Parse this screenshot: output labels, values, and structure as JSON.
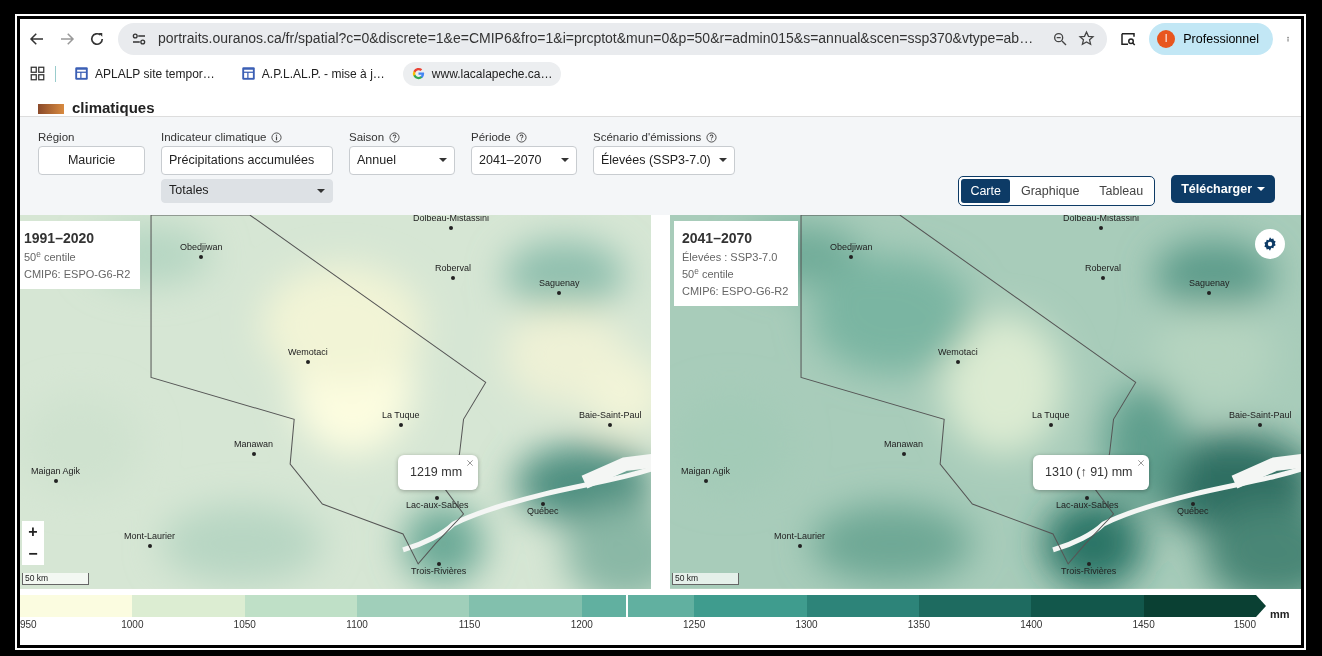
{
  "browser": {
    "url": "portraits.ouranos.ca/fr/spatial?c=0&discrete=1&e=CMIP6&fro=1&i=prcptot&mun=0&p=50&r=admin015&s=annual&scen=ssp370&vtype=ab…",
    "profile_initial": "I",
    "profile_name": "Professionnel"
  },
  "bookmarks": [
    {
      "kind": "page",
      "label": "APLALP site tempor…"
    },
    {
      "kind": "page",
      "label": "A.P.L.AL.P. - mise à j…"
    },
    {
      "kind": "google",
      "label": "www.lacalapeche.ca…"
    }
  ],
  "site_header": {
    "title": "climatiques"
  },
  "filters": [
    {
      "label": "Région",
      "kind": "button",
      "value": "Mauricie"
    },
    {
      "label": "Indicateur climatique",
      "info_button": true,
      "kind": "input",
      "value": "Précipitations accumulées",
      "sub_value": "Totales"
    },
    {
      "label": "Saison",
      "help_button": true,
      "kind": "select",
      "value": "Annuel"
    },
    {
      "label": "Période",
      "help_button": true,
      "kind": "select",
      "value": "2041–2070"
    },
    {
      "label": "Scénario d'émissions",
      "help_button": true,
      "kind": "select",
      "value": "Élevées (SSP3-7.0)"
    }
  ],
  "view_tabs": [
    {
      "label": "Carte",
      "selected": true
    },
    {
      "label": "Graphique",
      "selected": false
    },
    {
      "label": "Tableau",
      "selected": false
    }
  ],
  "download_button": "Télécharger",
  "maps": [
    {
      "title": "1991–2020",
      "lines": [
        "50$^{e}$ centile",
        "CMIP6: ESPO-G6-R2"
      ],
      "popup": "1219 mm",
      "zoom_buttons": [
        "+",
        "−"
      ],
      "scale": "50 km",
      "cities": [
        "Dolbeau-Mistassini",
        "Obedjiwan",
        "Roberval",
        "Saguenay",
        "Wemotaci",
        "La Tuque",
        "Manawan",
        "Maigan Agik",
        "Baie-Saint-Paul",
        "Lac-aux-Sables",
        "Québec",
        "Mont-Laurier",
        "Trois-Rivières"
      ]
    },
    {
      "title": "2041–2070",
      "lines": [
        "Élevées : SSP3-7.0",
        "50$^{e}$ centile",
        "CMIP6: ESPO-G6-R2"
      ],
      "popup": "1310 (↑ 91) mm",
      "settings_button": true,
      "scale": "50 km",
      "cities": [
        "Dolbeau-Mistassini",
        "Obedjiwan",
        "Roberval",
        "Saguenay",
        "Wemotaci",
        "La Tuque",
        "Manawan",
        "Maigan Agik",
        "Baie-Saint-Paul",
        "Lac-aux-Sables",
        "Québec",
        "Mont-Laurier",
        "Trois-Rivières"
      ]
    }
  ],
  "legend": {
    "unit": "mm",
    "level": 0.49,
    "bins": [
      {
        "color": "#fbfce0"
      },
      {
        "color": "#dcedd2"
      },
      {
        "color": "#bfe0c7"
      },
      {
        "color": "#a0cfba"
      },
      {
        "color": "#82c0ad"
      },
      {
        "color": "#61b0a0"
      },
      {
        "color": "#3f9c8e"
      },
      {
        "color": "#2d8479"
      },
      {
        "color": "#1e6b60"
      },
      {
        "color": "#12574b"
      },
      {
        "color": "#0a4033"
      }
    ],
    "ticks": [
      "950",
      "1000",
      "1050",
      "1100",
      "1150",
      "1200",
      "1250",
      "1300",
      "1350",
      "1400",
      "1450",
      "1500"
    ]
  }
}
